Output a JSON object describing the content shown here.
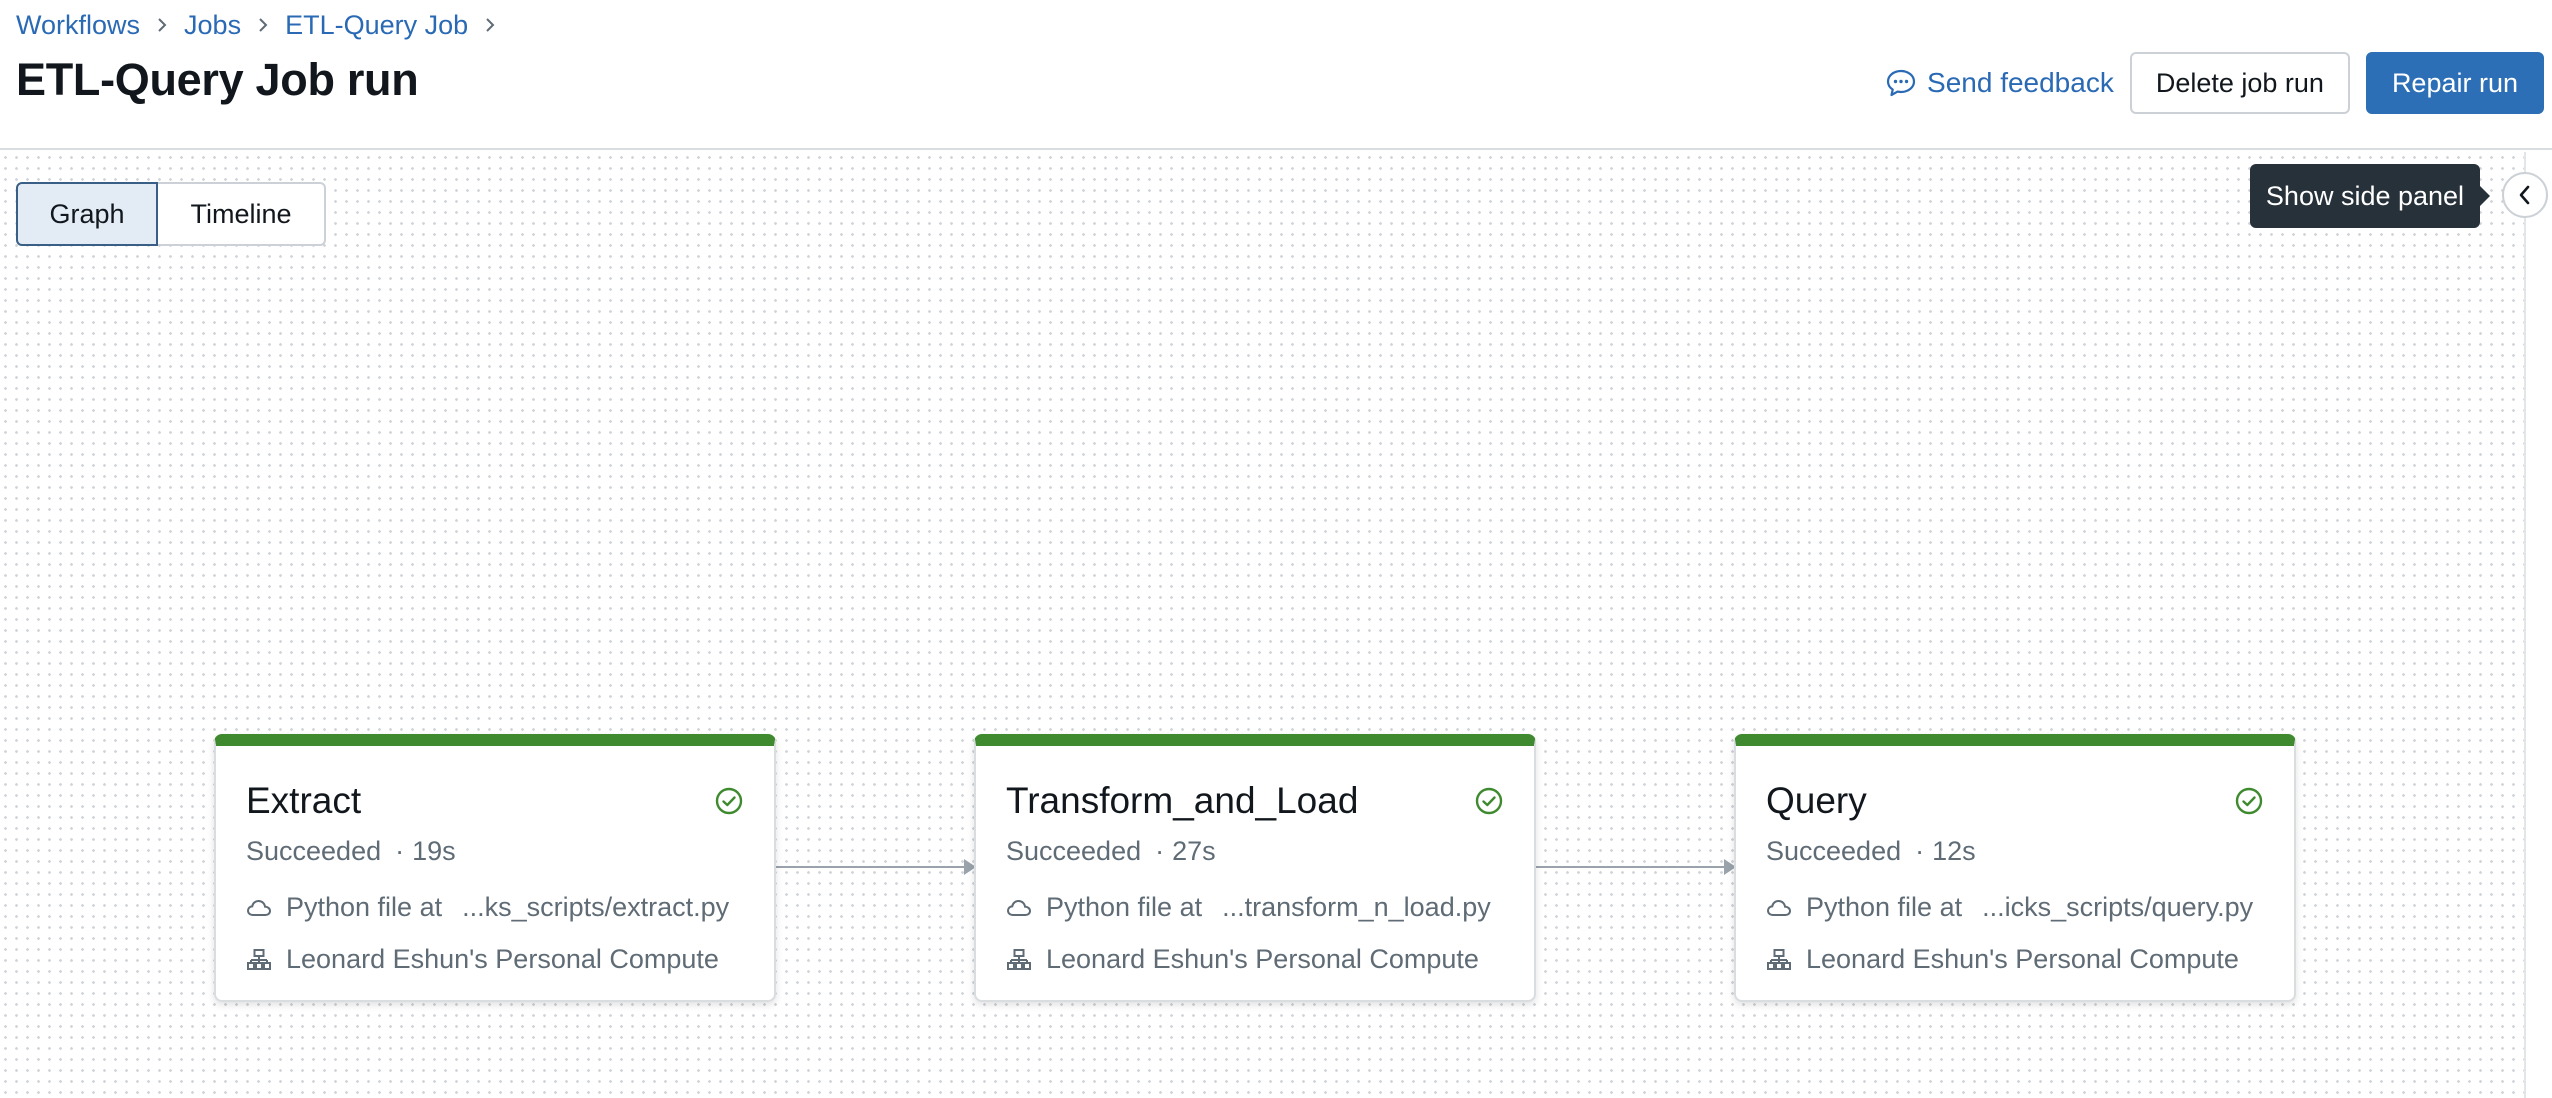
{
  "breadcrumb": {
    "items": [
      {
        "label": "Workflows"
      },
      {
        "label": "Jobs"
      },
      {
        "label": "ETL-Query Job"
      }
    ]
  },
  "header": {
    "title": "ETL-Query Job run",
    "feedback_label": "Send feedback",
    "delete_label": "Delete job run",
    "repair_label": "Repair run"
  },
  "view_toggle": {
    "graph_label": "Graph",
    "timeline_label": "Timeline",
    "selected": "Graph"
  },
  "side_panel": {
    "tooltip": "Show side panel"
  },
  "colors": {
    "accent": "#2d6fb7",
    "link": "#2a6ab5",
    "success": "#3f8a2f"
  },
  "tasks": [
    {
      "name": "Extract",
      "status": "Succeeded",
      "separator": "·",
      "duration": "19s",
      "file_prefix": "Python file at",
      "file_path": "...ks_scripts/extract.py",
      "compute": "Leonard Eshun's Personal Compute",
      "status_icon": "check-circle-icon"
    },
    {
      "name": "Transform_and_Load",
      "status": "Succeeded",
      "separator": "·",
      "duration": "27s",
      "file_prefix": "Python file at",
      "file_path": "...transform_n_load.py",
      "compute": "Leonard Eshun's Personal Compute",
      "status_icon": "check-circle-icon"
    },
    {
      "name": "Query",
      "status": "Succeeded",
      "separator": "·",
      "duration": "12s",
      "file_prefix": "Python file at",
      "file_path": "...icks_scripts/query.py",
      "compute": "Leonard Eshun's Personal Compute",
      "status_icon": "check-circle-icon"
    }
  ]
}
